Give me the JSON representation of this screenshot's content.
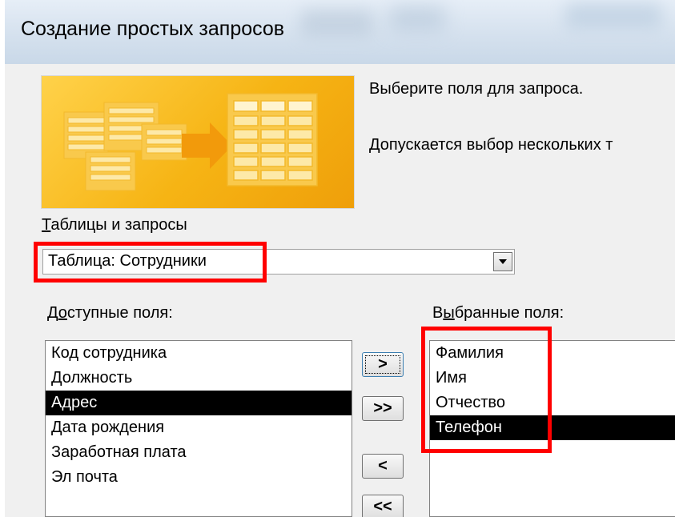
{
  "window": {
    "title": "Создание простых запросов"
  },
  "description": {
    "line1": "Выберите поля для запроса.",
    "line2": "Допускается выбор нескольких т"
  },
  "tables_queries": {
    "label": "Таблицы и запросы",
    "selected_value": "Таблица: Сотрудники"
  },
  "available_fields": {
    "label": "Доступные поля:",
    "items": [
      {
        "label": "Код сотрудника"
      },
      {
        "label": "Должность"
      },
      {
        "label": "Адрес",
        "selected": true
      },
      {
        "label": "Дата рождения"
      },
      {
        "label": "Заработная плата"
      },
      {
        "label": "Эл почта"
      }
    ]
  },
  "selected_fields": {
    "label": "Выбранные поля:",
    "items": [
      {
        "label": "Фамилия"
      },
      {
        "label": "Имя"
      },
      {
        "label": "Отчество"
      },
      {
        "label": "Телефон",
        "selected": true
      }
    ]
  },
  "move_buttons": {
    "add_one": ">",
    "add_all": ">>",
    "remove_one": "<",
    "remove_all": "<<"
  },
  "colors": {
    "highlight": "#ff0000",
    "selection": "#000000",
    "banner": "#f6b414"
  }
}
